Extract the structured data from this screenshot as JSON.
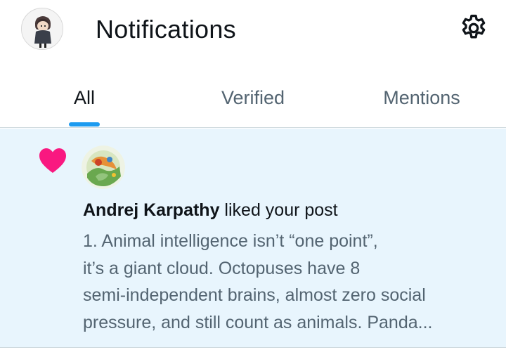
{
  "header": {
    "title": "Notifications",
    "avatar_icon": "profile-avatar-icon",
    "settings_icon": "gear-icon"
  },
  "tabs": [
    {
      "label": "All",
      "active": true
    },
    {
      "label": "Verified",
      "active": false
    },
    {
      "label": "Mentions",
      "active": false
    }
  ],
  "colors": {
    "accent": "#1d9bf0",
    "heart": "#f91880",
    "notif_bg": "#e8f5fd",
    "muted_text": "#536471"
  },
  "notification": {
    "type_icon": "heart-icon",
    "user_name": "Andrej Karpathy",
    "action": " liked your post",
    "preview_lines": [
      "1. Animal intelligence isn’t “one point”,",
      "it’s a giant cloud. Octopuses have 8",
      "semi-independent brains, almost zero social",
      "pressure, and still count as animals. Panda..."
    ]
  }
}
